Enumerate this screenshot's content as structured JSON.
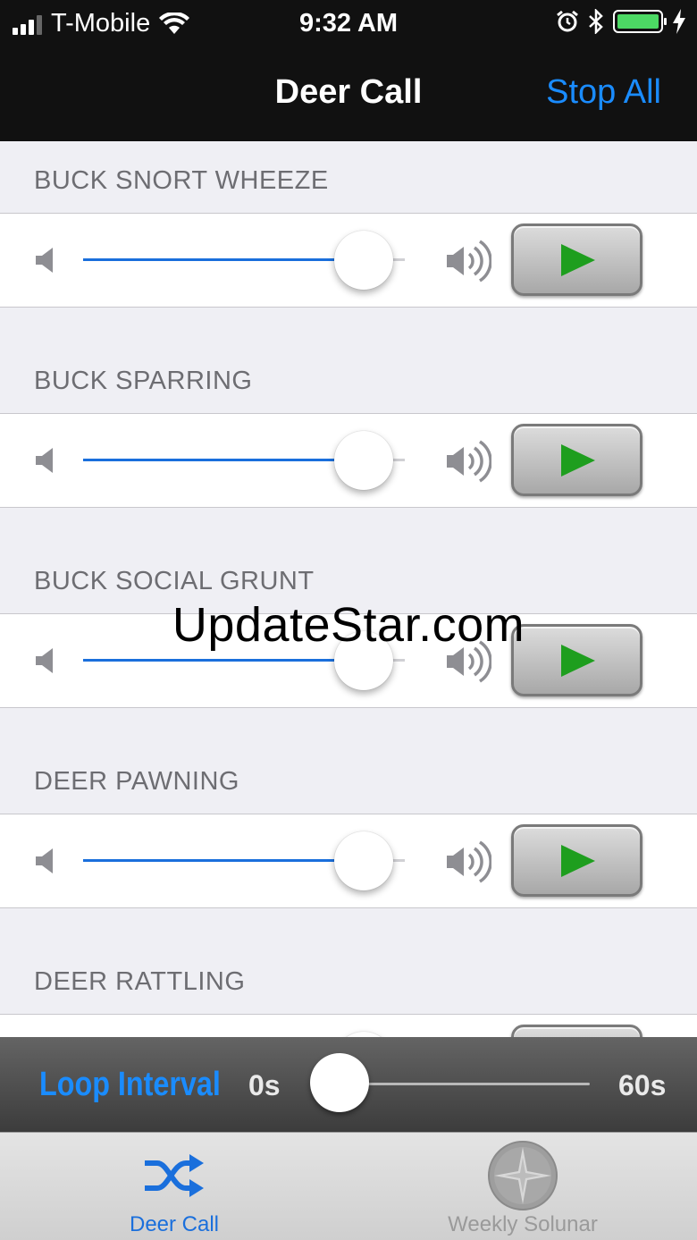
{
  "status": {
    "carrier": "T-Mobile",
    "time": "9:32 AM"
  },
  "nav": {
    "title": "Deer Call",
    "stop_all": "Stop All"
  },
  "calls": [
    {
      "name": "BUCK SNORT WHEEZE",
      "volume": 0.93
    },
    {
      "name": "BUCK SPARRING",
      "volume": 0.93
    },
    {
      "name": "BUCK SOCIAL GRUNT",
      "volume": 0.93
    },
    {
      "name": "DEER PAWNING",
      "volume": 0.93
    },
    {
      "name": "DEER RATTLING",
      "volume": 0.93
    }
  ],
  "loop": {
    "label": "Loop Interval",
    "min": "0s",
    "max": "60s",
    "value_fraction": 0.0
  },
  "tabs": [
    {
      "label": "Deer Call",
      "icon": "shuffle-icon",
      "selected": true
    },
    {
      "label": "Weekly Solunar",
      "icon": "compass-icon",
      "selected": false
    }
  ],
  "watermark": "UpdateStar.com",
  "colors": {
    "accent": "#1a8cff",
    "play_icon": "#1e9e1e",
    "slider_fill": "#1a6fdc"
  }
}
